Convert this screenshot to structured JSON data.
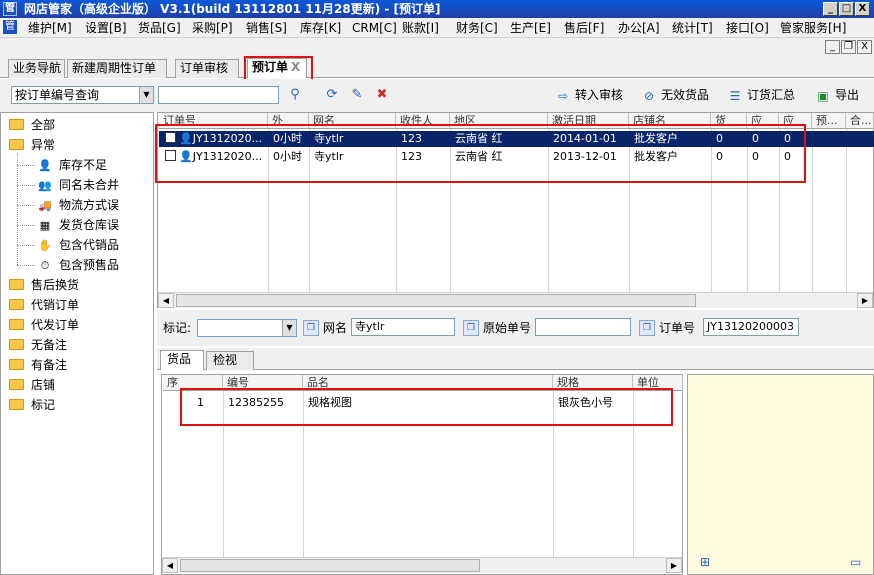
{
  "window": {
    "title": "网店管家（高级企业版） V3.1(build 13112801 11月28更新) - [预订单]",
    "logo_char": "管",
    "min": "_",
    "max": "□",
    "close": "X"
  },
  "menu": [
    "维护[M]",
    "设置[B]",
    "货品[G]",
    "采购[P]",
    "销售[S]",
    "库存[K]",
    "CRM[C]",
    "账款[I]",
    "财务[C]",
    "生产[E]",
    "售后[F]",
    "办公[A]",
    "统计[T]",
    "接口[O]",
    "管家服务[H]"
  ],
  "mdi": {
    "min": "_",
    "restore": "❐",
    "close": "X"
  },
  "doc_tabs": [
    {
      "label": "业务导航"
    },
    {
      "label": "新建周期性订单"
    },
    {
      "label": "订单审核"
    },
    {
      "label": "预订单",
      "close": "X"
    }
  ],
  "toolbar": {
    "query_mode": "按订单编号查询",
    "search_value": "",
    "buttons": [
      {
        "label": "转入审核",
        "icon": "transfer-audit-icon"
      },
      {
        "label": "无效货品",
        "icon": "invalid-goods-icon"
      },
      {
        "label": "订货汇总",
        "icon": "order-summary-icon"
      },
      {
        "label": "导出",
        "icon": "export-icon"
      }
    ]
  },
  "tree": {
    "items": [
      {
        "label": "全部"
      },
      {
        "label": "异常",
        "children": [
          "库存不足",
          "同名未合并",
          "物流方式误",
          "发货仓库误",
          "包含代销品",
          "包含预售品"
        ]
      },
      {
        "label": "售后换货"
      },
      {
        "label": "代销订单"
      },
      {
        "label": "代发订单"
      },
      {
        "label": "无备注"
      },
      {
        "label": "有备注"
      },
      {
        "label": "店铺"
      },
      {
        "label": "标记"
      }
    ]
  },
  "orders": {
    "columns": [
      "订单号",
      "外",
      "网名",
      "收件人",
      "地区",
      "激活日期",
      "店铺名",
      "货",
      "应",
      "应",
      "预...",
      "合..."
    ],
    "rows": [
      {
        "id": "JY1312020...",
        "out": "0小时",
        "nick": "寺ytlr",
        "recipient": "123",
        "region": "云南省 红",
        "date": "2014-01-01",
        "shop": "批发客户",
        "c1": "0",
        "c2": "0",
        "c3": "0",
        "selected": true
      },
      {
        "id": "JY1312020...",
        "out": "0小时",
        "nick": "寺ytlr",
        "recipient": "123",
        "region": "云南省 红",
        "date": "2013-12-01",
        "shop": "批发客户",
        "c1": "0",
        "c2": "0",
        "c3": "0",
        "selected": false
      }
    ]
  },
  "filter": {
    "mark_label": "标记:",
    "mark_value": "",
    "nick_label": "网名",
    "nick_value": "寺ytlr",
    "orig_label": "原始单号",
    "orig_value": "",
    "order_label": "订单号",
    "order_value": "JY13120200003"
  },
  "bottom_tabs": [
    "货品",
    "检视"
  ],
  "goods": {
    "columns": [
      "序",
      "编号",
      "品名",
      "规格",
      "单位"
    ],
    "rows": [
      {
        "seq": "1",
        "code": "12385255",
        "name": "规格视图",
        "spec": "银灰色小号",
        "unit": ""
      }
    ]
  }
}
